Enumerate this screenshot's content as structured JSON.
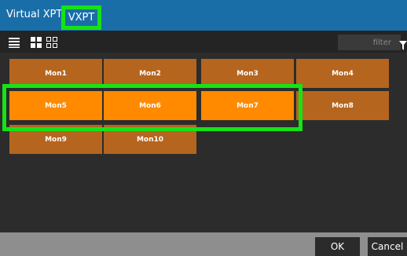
{
  "header": {
    "title": "Virtual XPT",
    "tab_label": "VXPT"
  },
  "toolbar": {
    "view_icons": [
      "list-view-icon",
      "large-grid-view-icon",
      "small-grid-view-icon"
    ],
    "filter_placeholder": "filter"
  },
  "grid": {
    "tiles": [
      {
        "label": "Mon1",
        "selected": false
      },
      {
        "label": "Mon2",
        "selected": false
      },
      {
        "label": "Mon3",
        "selected": false
      },
      {
        "label": "Mon4",
        "selected": false
      },
      {
        "label": "Mon5",
        "selected": true
      },
      {
        "label": "Mon6",
        "selected": true
      },
      {
        "label": "Mon7",
        "selected": true
      },
      {
        "label": "Mon8",
        "selected": false
      },
      {
        "label": "Mon9",
        "selected": false
      },
      {
        "label": "Mon10",
        "selected": false
      }
    ]
  },
  "footer": {
    "ok_label": "OK",
    "cancel_label": "Cancel"
  },
  "colors": {
    "header": "#1a6ea8",
    "tile": "#b5651e",
    "tile_selected": "#ff8a00",
    "highlight": "#16e316"
  }
}
